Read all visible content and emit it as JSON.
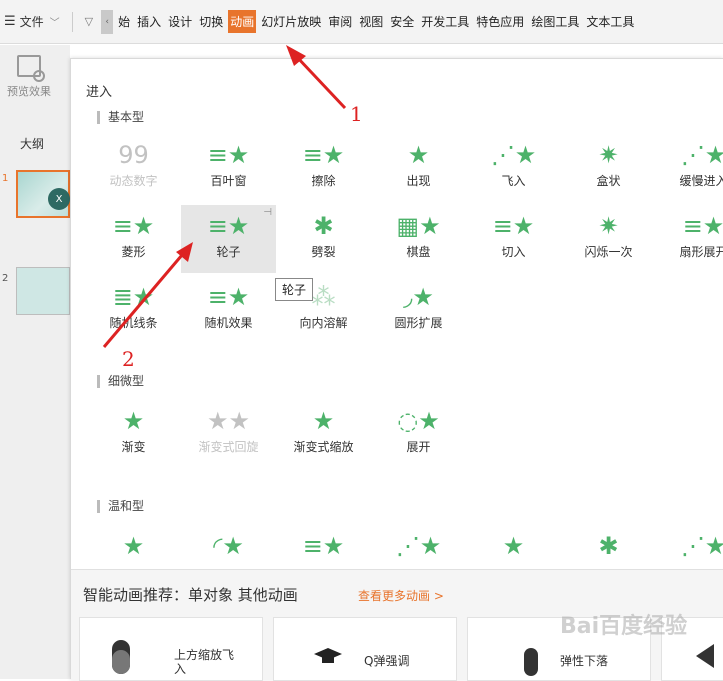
{
  "menubar": {
    "file_label": "文件",
    "tabs": [
      "始",
      "插入",
      "设计",
      "切换",
      "动画",
      "幻灯片放映",
      "审阅",
      "视图",
      "安全",
      "开发工具",
      "特色应用",
      "绘图工具",
      "文本工具"
    ],
    "active_tab": "动画"
  },
  "left": {
    "preview_label": "预览效果",
    "outline_tab": "大纲",
    "slide1_num": "1",
    "slide1_badge": "X",
    "slide2_num": "2"
  },
  "panel": {
    "title": "进入",
    "sections": {
      "basic": "基本型",
      "subtle": "细微型",
      "moderate": "温和型"
    },
    "basic_items": [
      "动态数字",
      "百叶窗",
      "擦除",
      "出现",
      "飞入",
      "盒状",
      "缓慢进入",
      "菱形",
      "轮子",
      "劈裂",
      "棋盘",
      "切入",
      "闪烁一次",
      "扇形展开",
      "随机线条",
      "随机效果",
      "向内溶解",
      "圆形扩展"
    ],
    "subtle_items": [
      "渐变",
      "渐变式回旋",
      "渐变式缩放",
      "展开"
    ],
    "tooltip": "轮子"
  },
  "recommend": {
    "title": "智能动画推荐：单对象 其他动画",
    "more_link": "查看更多动画 >",
    "cards": [
      {
        "label": "上方缩放飞入"
      },
      {
        "label": "Q弹强调"
      },
      {
        "label": "弹性下落"
      }
    ]
  },
  "annotations": {
    "arrow1_num": "1",
    "arrow2_num": "2"
  },
  "watermark": "Bai百度经验",
  "colors": {
    "accent": "#e8742c",
    "star_green": "#4db26a",
    "annotation_red": "#d22222"
  }
}
